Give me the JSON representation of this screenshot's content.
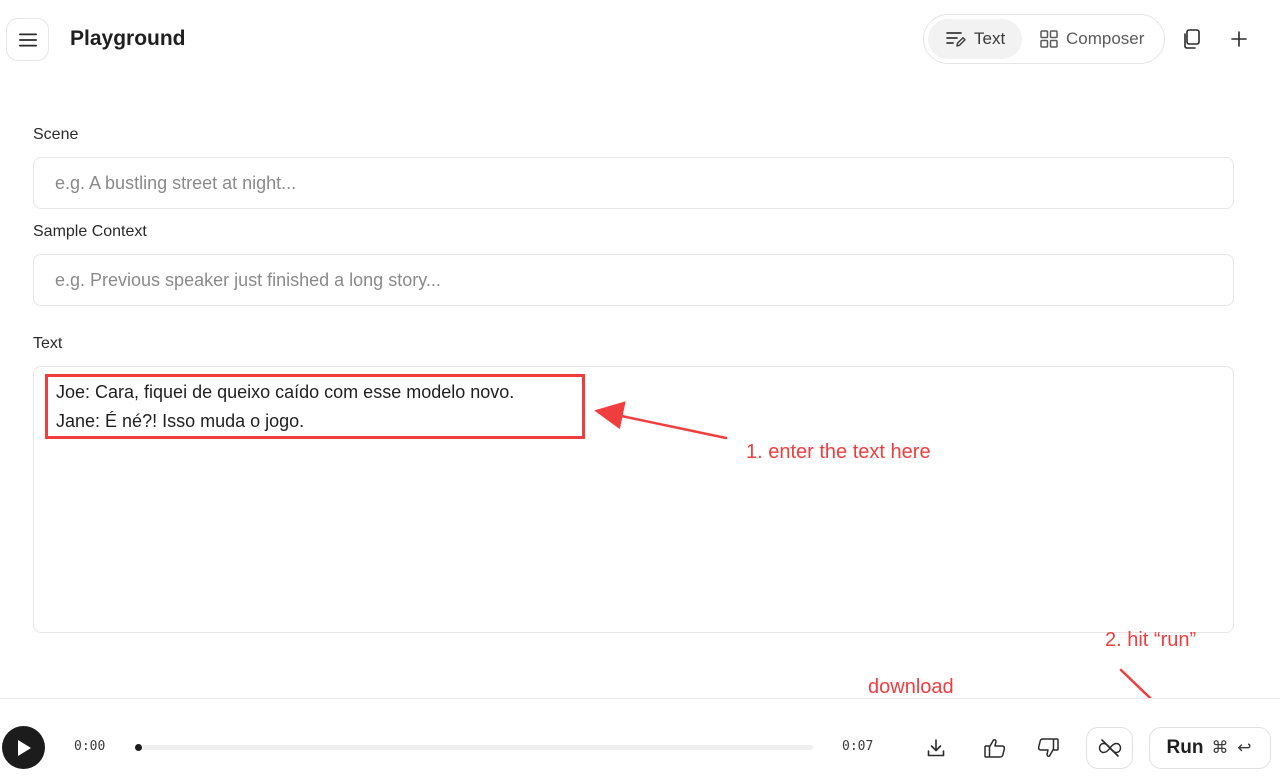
{
  "header": {
    "title": "Playground",
    "modes": [
      {
        "label": "Text",
        "active": true
      },
      {
        "label": "Composer",
        "active": false
      }
    ]
  },
  "form": {
    "scene": {
      "label": "Scene",
      "placeholder": "e.g. A bustling street at night...",
      "value": ""
    },
    "sample_context": {
      "label": "Sample Context",
      "placeholder": "e.g. Previous speaker just finished a long story...",
      "value": ""
    },
    "text": {
      "label": "Text",
      "lines": [
        "Joe: Cara, fiquei de queixo caído com esse modelo novo.",
        "Jane: É né?! Isso muda o jogo."
      ]
    }
  },
  "annotations": {
    "enter_text": "1. enter the text here",
    "download": "download",
    "hit_run": "2. hit “run”",
    "color": "#f03e3e"
  },
  "player": {
    "current_time": "0:00",
    "duration": "0:07",
    "progress": 0
  },
  "actions": {
    "run_label": "Run",
    "run_shortcut": "⌘ ↩"
  },
  "icons": {
    "menu": "hamburger-menu-icon",
    "text_mode": "text-lines-pen-icon",
    "composer_mode": "grid-icon",
    "copy": "copy-icon",
    "add": "plus-icon",
    "play": "play-icon",
    "download": "download-icon",
    "like": "thumbs-up-icon",
    "dislike": "thumbs-down-icon",
    "loop": "infinity-slash-icon"
  }
}
